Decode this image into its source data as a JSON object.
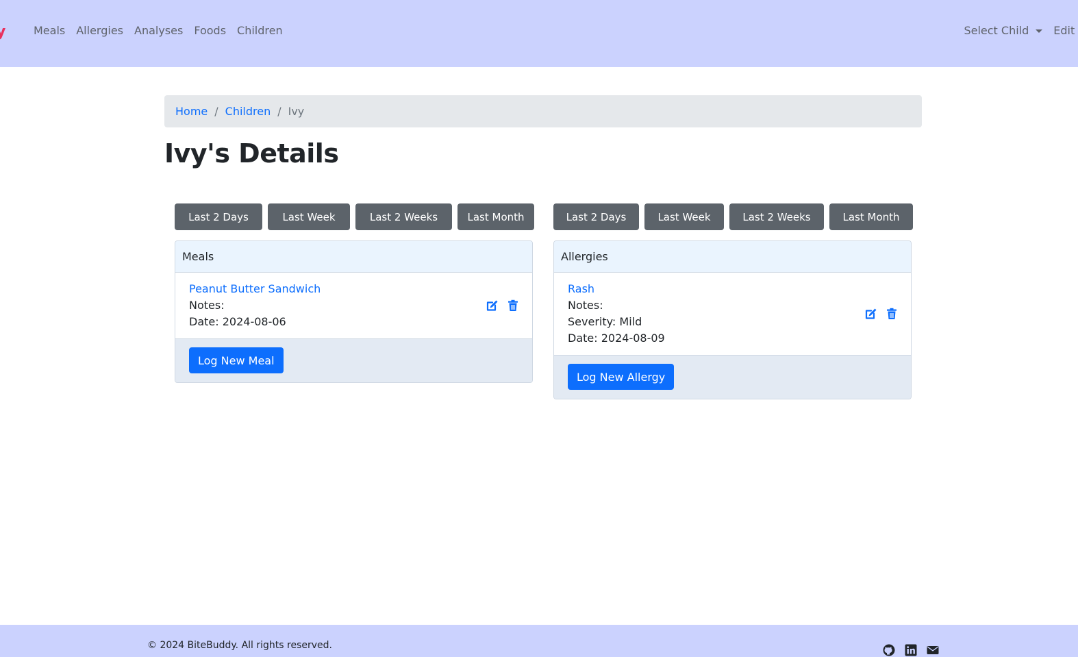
{
  "navbar": {
    "brand_fragment": "y",
    "links": [
      "Meals",
      "Allergies",
      "Analyses",
      "Foods",
      "Children"
    ],
    "select_child": "Select Child",
    "edit_fragment": "Edit P"
  },
  "breadcrumb": {
    "home": "Home",
    "children": "Children",
    "current": "Ivy",
    "separator": "/"
  },
  "page_title": "Ivy's Details",
  "filters": [
    "Last 2 Days",
    "Last Week",
    "Last 2 Weeks",
    "Last Month"
  ],
  "meals_card": {
    "header": "Meals",
    "item": {
      "title": "Peanut Butter Sandwich",
      "notes": "Notes:",
      "date": "Date: 2024-08-06"
    },
    "button": "Log New Meal"
  },
  "allergies_card": {
    "header": "Allergies",
    "item": {
      "title": "Rash",
      "notes": "Notes:",
      "severity": "Severity: Mild",
      "date": "Date: 2024-08-09"
    },
    "button": "Log New Allergy"
  },
  "footer": {
    "copyright": "© 2024 BiteBuddy. All rights reserved.",
    "social_icons": [
      "github-icon",
      "linkedin-icon",
      "envelope-icon"
    ]
  },
  "colors": {
    "navbar_bg": "#cbd2fe",
    "primary": "#0d6efd",
    "secondary_btn": "#5c636a",
    "brand_accent": "#e8305d"
  }
}
